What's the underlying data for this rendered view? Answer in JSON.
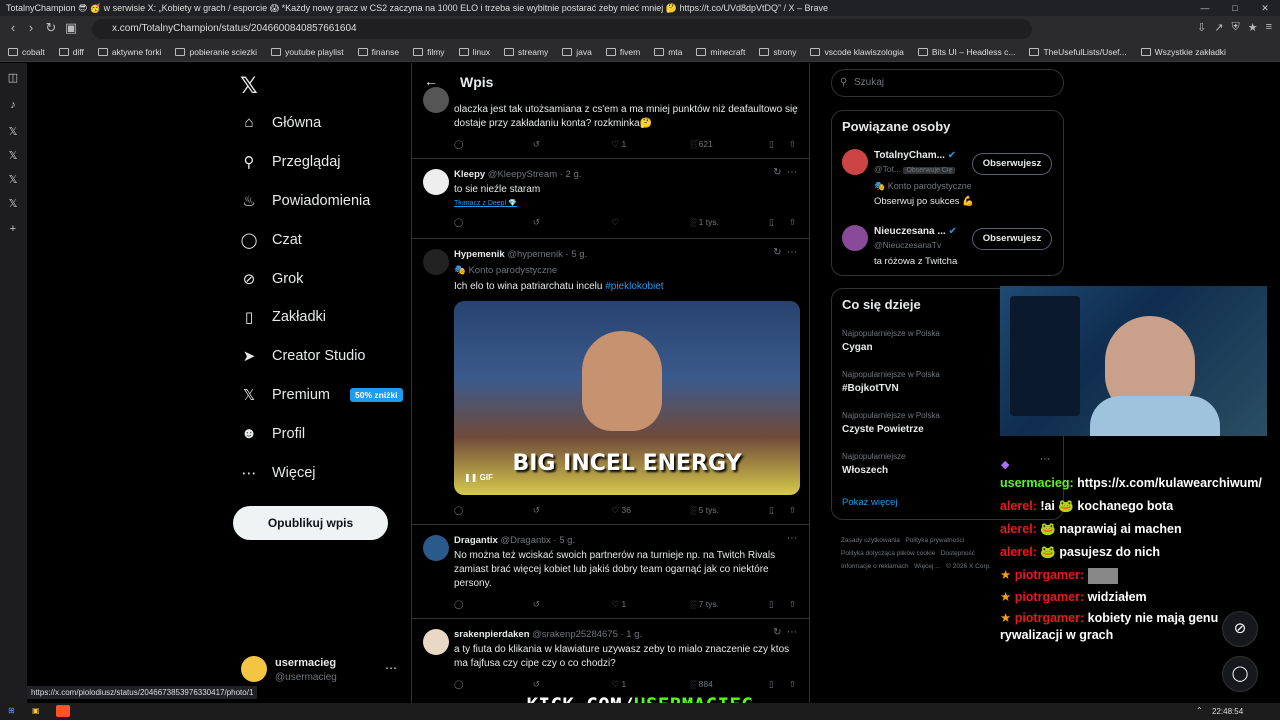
{
  "window": {
    "title": "TotalnyChampion 😎 🥳 w serwisie X: „Kobiety w grach / esporcie 😱 *Każdy nowy gracz w CS2 zaczyna na 1000 ELO i trzeba sie wybitnie postarać żeby mieć mniej 🤔 https://t.co/UVd8dpVtDQ” / X – Brave",
    "url": "x.com/TotalnyChampion/status/2046600840857661604"
  },
  "bookmarks": [
    "cobalt",
    "diff",
    "aktywne forki",
    "pobieranie sciezki",
    "youtube playlist",
    "finanse",
    "filmy",
    "linux",
    "streamy",
    "java",
    "fivem",
    "mta",
    "minecraft",
    "strony",
    "vscode klawiszologia",
    "Bits UI – Headless c...",
    "TheUsefulLists/Usef...",
    "Wszystkie zakładki"
  ],
  "nav": {
    "items": [
      "Główna",
      "Przeglądaj",
      "Powiadomienia",
      "Czat",
      "Grok",
      "Zakładki",
      "Creator Studio",
      "Premium",
      "Profil",
      "Więcej"
    ],
    "premium_badge": "50% zniżki",
    "post_button": "Opublikuj wpis",
    "user_name": "usermacieg",
    "user_handle": "@usermacieg"
  },
  "feed": {
    "header": "Wpis",
    "tweets": [
      {
        "text": "olaczka jest tak utożsamiana z cs'em a ma mniej punktów niż deafaultowo się dostaje przy zakładaniu konta? rozkminka🤔",
        "likes": "1",
        "views": "621"
      },
      {
        "name": "Kleepy",
        "handle": "@KleepyStream · 2 g.",
        "text": "to sie nieźle staram",
        "translate": "Tłumacz z Deepl 💎",
        "likes": "",
        "views": "1 tys."
      },
      {
        "name": "Hypemenik",
        "handle": "@hypemenik · 5 g.",
        "parody": "🎭 Konto parodystyczne",
        "text": "Ich elo to wina patriarchatu incelu ",
        "hashtag": "#pieklokobiet",
        "gif_caption": "BIG INCEL ENERGY",
        "gif_tag": "GIF",
        "likes": "36",
        "views": "5 tys."
      },
      {
        "name": "Dragantix",
        "handle": "@Dragantix · 5 g.",
        "text": "No można też wciskać swoich partnerów na turnieje np. na Twitch Rivals zamiast brać więcej kobiet lub jakiś dobry team ogarnąć jak co niektóre persony.",
        "likes": "1",
        "views": "7 tys."
      },
      {
        "name": "srakenpierdaken",
        "handle": "@srakenp25284675 · 1 g.",
        "text": "a ty fiuta do klikania w klawiature uzywasz zeby to mialo znaczenie czy ktos ma fajfusa czy cipe czy o co chodzi?",
        "likes": "1",
        "views": "884"
      }
    ]
  },
  "right": {
    "search_placeholder": "Szukaj",
    "related_title": "Powiązane osoby",
    "people": [
      {
        "name": "TotalnyCham...",
        "handle": "@Tot...",
        "follows_you": "Obserwuje Cię",
        "parody": "🎭 Konto parodystyczne",
        "bio": "Obserwuj po sukces 💪",
        "button": "Obserwujesz"
      },
      {
        "name": "Nieuczesana ...",
        "handle": "@NieuczesanaTv",
        "bio": "ta różowa z Twitcha",
        "button": "Obserwujesz"
      }
    ],
    "trends_title": "Co się dzieje",
    "trends": [
      {
        "cat": "Najpopularniejsze w Polska",
        "name": "Cygan"
      },
      {
        "cat": "Najpopularniejsze w Polska",
        "name": "#BojkotTVN"
      },
      {
        "cat": "Najpopularniejsze w Polska",
        "name": "Czyste Powietrze"
      },
      {
        "cat": "Najpopularniejsze",
        "name": "Włoszech"
      }
    ],
    "show_more": "Pokaż więcej",
    "footer": [
      "Zasady użytkowania",
      "Polityka prywatności",
      "Polityka dotycząca plików cookie",
      "Dostępność",
      "Informacje o reklamach",
      "Więcej ...",
      "© 2026 X Corp."
    ]
  },
  "chat": [
    {
      "name": "usermacieg:",
      "msg": " https://x.com/kulawearchiwum/"
    },
    {
      "name": "alerel:",
      "msg": " !ai 🐸 kochanego bota"
    },
    {
      "name": "alerel:",
      "msg": " 🐸 naprawiaj ai machen"
    },
    {
      "name": "alerel:",
      "msg": " 🐸 pasujesz do nich"
    },
    {
      "name": "piotrgamer:",
      "msg": ""
    },
    {
      "name": "piotrgamer:",
      "msg": " widziałem"
    },
    {
      "name": "piotrgamer:",
      "msg": " kobiety nie mają genu rywalizacji w grach"
    }
  ],
  "kick": {
    "prefix": "KICK.COM/",
    "channel": "USERMACIEG"
  },
  "status_url": "https://x.com/piolodiusz/status/2046673853976330417/photo/1",
  "clock": "22:48:54"
}
